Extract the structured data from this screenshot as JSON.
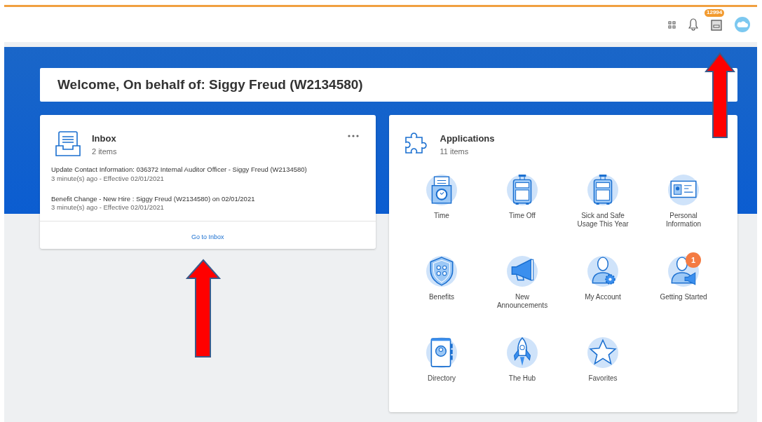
{
  "header": {
    "notification_count": "12994"
  },
  "welcome": {
    "title": "Welcome, On behalf of: Siggy Freud (W2134580)"
  },
  "inbox": {
    "title": "Inbox",
    "count": "2 items",
    "items": [
      {
        "title": "Update Contact Information: 036372 Internal Auditor Officer - Siggy Freud (W2134580)",
        "meta": "3 minute(s) ago - Effective 02/01/2021"
      },
      {
        "title": "Benefit Change - New Hire : Siggy Freud (W2134580) on 02/01/2021",
        "meta": "3 minute(s) ago - Effective 02/01/2021"
      }
    ],
    "link": "Go to Inbox"
  },
  "applications": {
    "title": "Applications",
    "count": "11 items",
    "apps": [
      {
        "label": "Time",
        "kind": "clock"
      },
      {
        "label": "Time Off",
        "kind": "suitcase"
      },
      {
        "label": "Sick and Safe Usage This Year",
        "kind": "suitcase"
      },
      {
        "label": "Personal Information",
        "kind": "idcard"
      },
      {
        "label": "Benefits",
        "kind": "shield"
      },
      {
        "label": "New Announcements",
        "kind": "megaphone"
      },
      {
        "label": "My Account",
        "kind": "account"
      },
      {
        "label": "Getting Started",
        "kind": "starter",
        "badge": "1"
      },
      {
        "label": "Directory",
        "kind": "book"
      },
      {
        "label": "The Hub",
        "kind": "rocket"
      },
      {
        "label": "Favorites",
        "kind": "star"
      }
    ]
  }
}
